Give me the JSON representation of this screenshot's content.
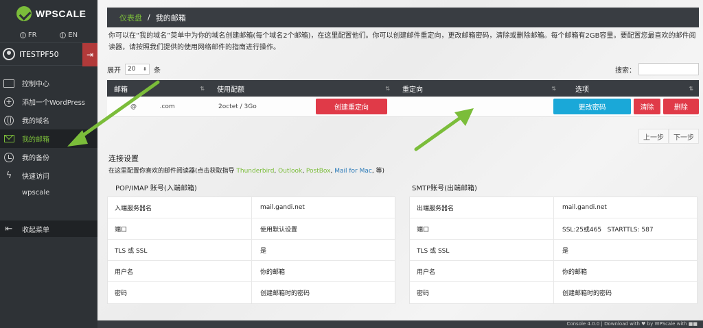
{
  "brand": {
    "name": "WPSCALE"
  },
  "sidebar": {
    "langs": [
      "FR",
      "EN"
    ],
    "user": "ITESTPF50",
    "items": [
      {
        "label": "控制中心",
        "icon": "monitor-icon"
      },
      {
        "label": "添加一个WordPress",
        "icon": "plus-circle-icon"
      },
      {
        "label": "我的域名",
        "icon": "globe-icon"
      },
      {
        "label": "我的邮箱",
        "icon": "envelope-icon",
        "active": true
      },
      {
        "label": "我的备份",
        "icon": "backup-icon"
      },
      {
        "label": "快速访问",
        "icon": "bolt-icon"
      }
    ],
    "sub_item": "wpscale",
    "collapse_label": "收起菜单"
  },
  "breadcrumb": {
    "home": "仪表盘",
    "sep": "/",
    "current": "我的邮箱"
  },
  "intro": "你可以在“我的域名”菜单中为你的域名创建邮箱(每个域名2个邮箱)，在这里配置他们。你可以创建邮件重定向，更改邮箱密码，清除或删除邮箱。每个邮箱有2GB容量。要配置您最喜欢的邮件阅读器，请按照我们提供的使用网络邮件的指南进行操作。",
  "table_controls": {
    "show_label": "展开",
    "page_size": "20",
    "entries_label": "条",
    "search_label": "搜索："
  },
  "mail_table": {
    "columns": [
      "邮箱",
      "使用配额",
      "重定向",
      "选项"
    ],
    "row": {
      "email_at": "@",
      "email_domain": "  .com",
      "quota": "2octet / 3Go",
      "redirect_button": "创建重定向",
      "password_button": "更改密码",
      "purge_button": "清除",
      "delete_button": "删除"
    }
  },
  "pager": {
    "prev": "上一步",
    "next": "下一步"
  },
  "connect": {
    "title": "连接设置",
    "desc_prefix": "在这里配置你喜欢的邮件阅读器(点击获取指导 ",
    "links": [
      "Thunderbird",
      "Outlook",
      "PostBox",
      "Mail for Mac"
    ],
    "desc_suffix": ", 等)"
  },
  "incoming": {
    "title": "POP/IMAP 账号(入端邮箱)",
    "rows": [
      {
        "k": "入端服务器名",
        "v": "mail.gandi.net"
      },
      {
        "k": "端口",
        "v": "使用默认设置"
      },
      {
        "k": "TLS 或 SSL",
        "v": "是"
      },
      {
        "k": "用户名",
        "v": "你的邮箱"
      },
      {
        "k": "密码",
        "v": "创建邮箱时的密码"
      }
    ]
  },
  "outgoing": {
    "title": "SMTP账号(出端邮箱)",
    "rows": [
      {
        "k": "出端服务器名",
        "v": "mail.gandi.net"
      },
      {
        "k": "端口",
        "v": "SSL:25或465   STARTTLS: 587"
      },
      {
        "k": "TLS 或 SSL",
        "v": "是"
      },
      {
        "k": "用户名",
        "v": "你的邮箱"
      },
      {
        "k": "密码",
        "v": "创建邮箱时的密码"
      }
    ]
  },
  "footer": "Console 4.0.0 | Download with ♥ by WPScale with ■■",
  "colors": {
    "accent": "#7bbd3a",
    "danger": "#e03a48",
    "info": "#1aa8d8",
    "dark": "#393d42"
  }
}
